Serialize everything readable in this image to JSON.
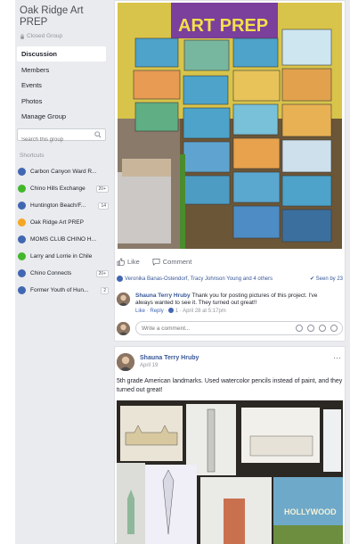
{
  "group": {
    "title": "Oak Ridge Art PREP",
    "privacy": "Closed Group"
  },
  "nav": {
    "items": [
      "Discussion",
      "Members",
      "Events",
      "Photos",
      "Manage Group"
    ]
  },
  "search": {
    "placeholder": "Search this group"
  },
  "shortcuts": {
    "heading": "Shortcuts",
    "items": [
      {
        "label": "Carbon Canyon Ward R...",
        "badge": "",
        "color": "#4267b2"
      },
      {
        "label": "Chino Hills Exchange",
        "badge": "20+",
        "color": "#42b72a"
      },
      {
        "label": "Huntington Beach/F...",
        "badge": "14",
        "color": "#4267b2"
      },
      {
        "label": "Oak Ridge Art PREP",
        "badge": "",
        "color": "#f5a623"
      },
      {
        "label": "MOMS CLUB CHINO H...",
        "badge": "",
        "color": "#4267b2"
      },
      {
        "label": "Larry and Lorrie in Chile",
        "badge": "",
        "color": "#42b72a"
      },
      {
        "label": "Chino Connects",
        "badge": "20+",
        "color": "#4267b2"
      },
      {
        "label": "Former Youth of Hun...",
        "badge": "2",
        "color": "#4267b2"
      }
    ]
  },
  "post1": {
    "banner_text": "ART PREP",
    "like_label": "Like",
    "comment_label": "Comment",
    "reactors": "Veronika Banas-Ostendorf, Tracy Johnson Young and 4 others",
    "seen": "Seen by 23",
    "comment": {
      "author": "Shauna Terry Hruby",
      "text": "Thank you for posting pictures of this project. I've always wanted to see it. They turned out great!!",
      "like": "Like",
      "reply": "Reply",
      "likes_count": "1",
      "time": "April 28 at 5:17pm"
    },
    "write_placeholder": "Write a comment..."
  },
  "post2": {
    "author": "Shauna Terry Hruby",
    "date": "April 19",
    "more": "···",
    "text": "5th grade American landmarks. Used watercolor pencils instead of paint, and they turned out great!",
    "sign_text": "HOLLYWOOD"
  },
  "colors": {
    "link": "#385898",
    "page_bg": "#e9ebee"
  }
}
